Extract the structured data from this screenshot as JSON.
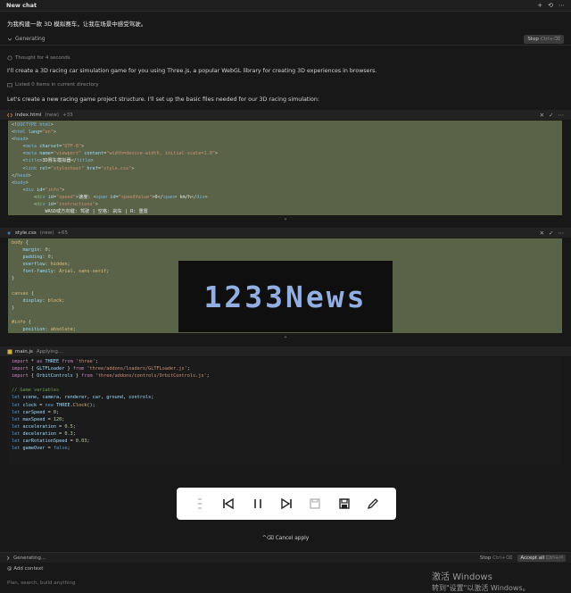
{
  "topbar": {
    "title": "New chat",
    "icons": [
      "+",
      "⟲",
      "⋯"
    ]
  },
  "prompt": "为我构建一款 3D 模拟赛车，让我在场景中感受驾驶。",
  "status": {
    "label": "Generating",
    "stop": "Stop",
    "stop_key": "Ctrl+⌫"
  },
  "thought": "Thought for 4 seconds",
  "listed": "Listed 0 items in current directory",
  "intro": "I'll create a 3D racing car simulation game for you using Three.js, a popular WebGL library for creating 3D experiences in browsers.",
  "plan_text": "Let's create a new racing game project structure. I'll set up the basic files needed for our 3D racing simulation:",
  "files": [
    {
      "name": "index.html",
      "tag": "(new)",
      "stat": "+33"
    },
    {
      "name": "style.css",
      "tag": "(new)",
      "stat": "+65"
    },
    {
      "name": "main.js",
      "tag": "",
      "stat": "Applying..."
    }
  ],
  "watermark": "1233News",
  "cancel": "^⌫ Cancel apply",
  "bottom": {
    "left": "Generating...",
    "stop": "Stop",
    "stop_key": "Ctrl+⌫",
    "accept": "Accept all",
    "accept_key": "Ctrl+⏎"
  },
  "add_context": "Add context",
  "input_placeholder": "Plan, search, build anything",
  "windows_activation": {
    "line1": "激活 Windows",
    "line2": "转到\"设置\"以激活 Windows。"
  },
  "colors": {
    "added_bg": "#5a6347",
    "bg": "#181818",
    "watermark_text": "#93aee0"
  }
}
